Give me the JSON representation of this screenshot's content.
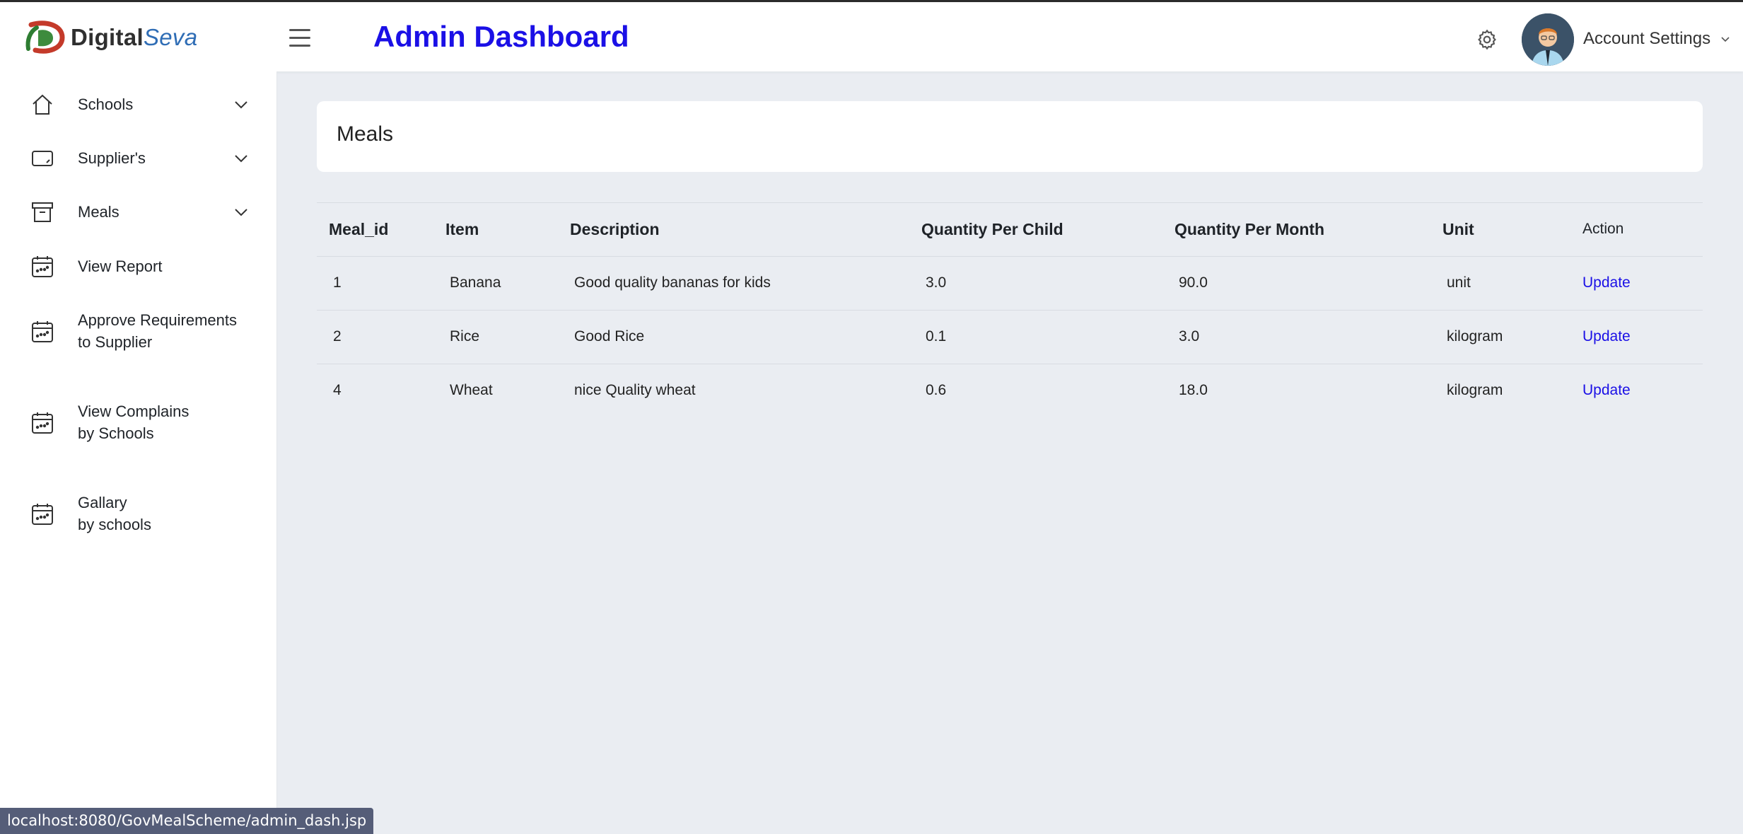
{
  "brand": {
    "name_part1": "Digital",
    "name_part2": "Seva"
  },
  "header": {
    "title": "Admin Dashboard",
    "account_label": "Account Settings"
  },
  "sidebar": {
    "items": [
      {
        "label": "Schools",
        "icon": "home-icon",
        "expandable": true
      },
      {
        "label": "Supplier's",
        "icon": "tablet-icon",
        "expandable": true
      },
      {
        "label": "Meals",
        "icon": "archive-icon",
        "expandable": true
      },
      {
        "label": "View Report",
        "icon": "calendar-icon",
        "expandable": false
      },
      {
        "label_line1": "Approve Requirements",
        "label_line2": "to Supplier",
        "icon": "calendar-icon",
        "expandable": false
      },
      {
        "label_line1": "View Complains",
        "label_line2": "by Schools",
        "icon": "calendar-icon",
        "expandable": false
      },
      {
        "label_line1": "Gallary",
        "label_line2": "by schools",
        "icon": "calendar-icon",
        "expandable": false
      }
    ]
  },
  "main": {
    "card_title": "Meals",
    "table": {
      "columns": [
        "Meal_id",
        "Item",
        "Description",
        "Quantity Per Child",
        "Quantity Per Month",
        "Unit",
        "Action"
      ],
      "rows": [
        {
          "meal_id": "1",
          "item": "Banana",
          "description": "Good quality bananas for kids",
          "qty_child": "3.0",
          "qty_month": "90.0",
          "unit": "unit",
          "action": "Update"
        },
        {
          "meal_id": "2",
          "item": "Rice",
          "description": "Good Rice",
          "qty_child": "0.1",
          "qty_month": "3.0",
          "unit": "kilogram",
          "action": "Update"
        },
        {
          "meal_id": "4",
          "item": "Wheat",
          "description": "nice Quality wheat",
          "qty_child": "0.6",
          "qty_month": "18.0",
          "unit": "kilogram",
          "action": "Update"
        }
      ]
    }
  },
  "statusbar": {
    "url": "localhost:8080/GovMealScheme/admin_dash.jsp"
  },
  "colors": {
    "accent": "#1b10e6",
    "background": "#eaedf2",
    "statusbar": "#555d78"
  }
}
